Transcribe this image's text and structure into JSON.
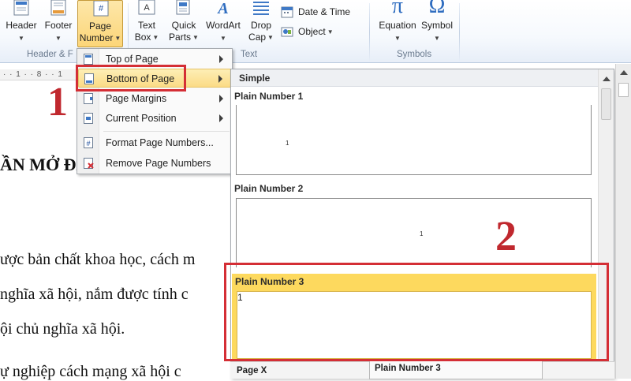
{
  "ribbon": {
    "buttons": [
      {
        "id": "header",
        "label": "Header",
        "icon": "header-icon"
      },
      {
        "id": "footer",
        "label": "Footer",
        "icon": "footer-icon"
      },
      {
        "id": "page_number",
        "label_line1": "Page",
        "label_line2": "Number",
        "icon": "page-number-icon"
      },
      {
        "id": "text_box",
        "label_line1": "Text",
        "label_line2": "Box",
        "icon": "text-box-icon"
      },
      {
        "id": "quick_parts",
        "label_line1": "Quick",
        "label_line2": "Parts",
        "icon": "quick-parts-icon"
      },
      {
        "id": "wordart",
        "label": "WordArt",
        "icon": "wordart-icon"
      },
      {
        "id": "drop_cap",
        "label_line1": "Drop",
        "label_line2": "Cap",
        "icon": "drop-cap-icon"
      },
      {
        "id": "date_time",
        "label": "Date & Time",
        "icon": "calendar-icon"
      },
      {
        "id": "object",
        "label": "Object",
        "icon": "object-icon"
      },
      {
        "id": "equation",
        "label": "Equation",
        "icon": "pi-icon"
      },
      {
        "id": "symbol",
        "label": "Symbol",
        "icon": "omega-icon"
      }
    ],
    "groups": {
      "header_footer": "Header & F",
      "text": "Text",
      "symbols": "Symbols"
    },
    "page_number_glyph": "#",
    "equation_glyph": "π",
    "symbol_glyph": "Ω"
  },
  "ruler": {
    "marks": "· · 1 · · 8 · · 1"
  },
  "document": {
    "heading_fragment": "ẦN MỞ ĐẦU",
    "lines": [
      "ược bản chất khoa học, cách m",
      "nghĩa xã hội, nắm được tính c",
      "ội chủ nghĩa xã hội.",
      "ự nghiệp cách mạng xã hội c"
    ]
  },
  "annotations": {
    "step1": "1",
    "step2": "2"
  },
  "menu": {
    "items": [
      {
        "label": "Top of Page",
        "icon": "page-top-icon",
        "submenu": true
      },
      {
        "label": "Bottom of Page",
        "icon": "page-bottom-icon",
        "submenu": true,
        "highlighted": true
      },
      {
        "label": "Page Margins",
        "icon": "page-margins-icon",
        "submenu": true
      },
      {
        "label": "Current Position",
        "icon": "current-position-icon",
        "submenu": true
      },
      {
        "label": "Format Page Numbers...",
        "icon": "format-page-numbers-icon",
        "submenu": false
      },
      {
        "label": "Remove Page Numbers",
        "icon": "remove-page-numbers-icon",
        "submenu": false
      }
    ]
  },
  "gallery": {
    "section": "Simple",
    "items": [
      {
        "title": "Plain Number 1",
        "sample": "1"
      },
      {
        "title": "Plain Number 2",
        "sample": "1"
      },
      {
        "title": "Plain Number 3",
        "sample": "1",
        "selected": true
      }
    ],
    "next_items": [
      "Page X",
      "Plain Number 3"
    ]
  },
  "colors": {
    "annotation_red": "#d42e35",
    "selected_yellow": "#fdd95e",
    "ribbon_blue": "#1f4e9c"
  }
}
